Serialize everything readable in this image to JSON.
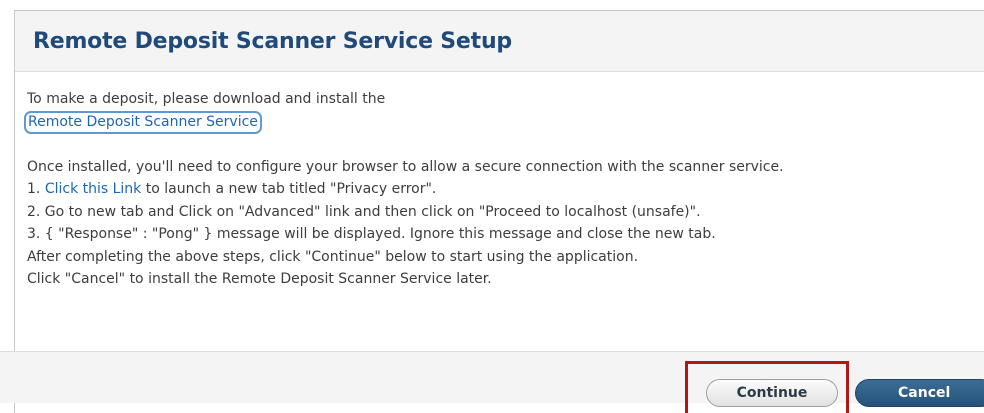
{
  "dialog": {
    "title": "Remote Deposit Scanner Service Setup",
    "intro_text": "To make a deposit, please download and install the",
    "service_link": "Remote Deposit Scanner Service",
    "config_text": "Once installed, you'll need to configure your browser to allow a secure connection with the scanner service.",
    "step1_prefix": "1. ",
    "step1_link": "Click this Link",
    "step1_suffix": " to launch a new tab titled \"Privacy error\".",
    "step2": "2. Go to new tab and Click on \"Advanced\" link and then click on \"Proceed to localhost (unsafe)\".",
    "step3": "3. { \"Response\" : \"Pong\" } message will be displayed. Ignore this message and close the new tab.",
    "after_text": "After completing the above steps, click \"Continue\" below to start using the application.",
    "cancel_text": "Click \"Cancel\" to install the Remote Deposit Scanner Service later.",
    "continue_label": "Continue",
    "cancel_label": "Cancel"
  },
  "colors": {
    "title": "#1f4a7a",
    "link": "#1e66b5",
    "highlight_box": "#b01818",
    "cancel_button": "#2b5a84"
  }
}
